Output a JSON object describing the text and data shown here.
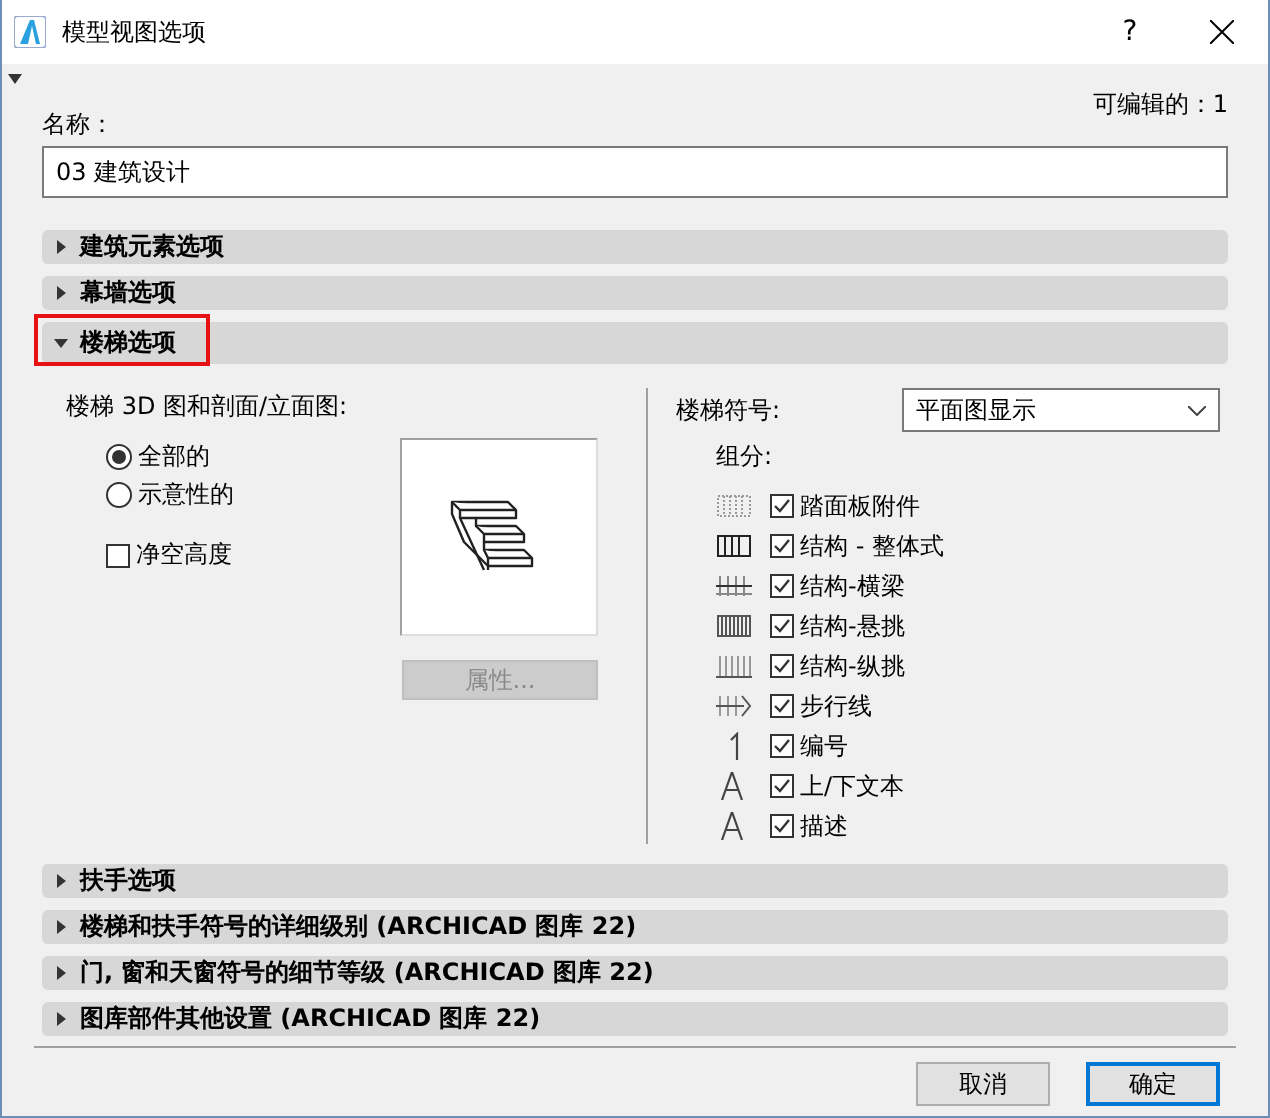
{
  "window": {
    "title": "模型视图选项",
    "help": "?"
  },
  "editable": {
    "label": "可编辑的：",
    "value": "1"
  },
  "name_field": {
    "label": "名称：",
    "value": "03 建筑设计"
  },
  "sections_top": [
    {
      "label": "建筑元素选项",
      "expanded": false,
      "highlighted": false
    },
    {
      "label": "幕墙选项",
      "expanded": false,
      "highlighted": false
    },
    {
      "label": "楼梯选项",
      "expanded": true,
      "highlighted": true
    }
  ],
  "stair_3d": {
    "label": "楼梯 3D 图和剖面/立面图:",
    "options": [
      {
        "label": "全部的",
        "selected": true
      },
      {
        "label": "示意性的",
        "selected": false
      }
    ],
    "clear_height": {
      "label": "净空高度",
      "checked": false
    },
    "properties_button": {
      "label": "属性...",
      "disabled": true
    }
  },
  "stair_symbol": {
    "label": "楼梯符号:",
    "value": "平面图显示",
    "components_label": "组分:",
    "components": [
      {
        "kind": "grid",
        "label": "踏面板附件",
        "checked": true
      },
      {
        "kind": "bars",
        "label": "结构 - 整体式",
        "checked": true
      },
      {
        "kind": "crossbar",
        "label": "结构-横梁",
        "checked": true
      },
      {
        "kind": "dense",
        "label": "结构-悬挑",
        "checked": true
      },
      {
        "kind": "underline",
        "label": "结构-纵挑",
        "checked": true
      },
      {
        "kind": "arrow",
        "label": "步行线",
        "checked": true
      },
      {
        "kind": "number",
        "label": "编号",
        "checked": true
      },
      {
        "kind": "letter",
        "label": "上/下文本",
        "checked": true
      },
      {
        "kind": "letter",
        "label": "描述",
        "checked": true
      }
    ]
  },
  "sections_bottom": [
    {
      "label": "扶手选项",
      "expanded": false
    },
    {
      "label": "楼梯和扶手符号的详细级别 (ARCHICAD 图库 22)",
      "expanded": false
    },
    {
      "label": "门, 窗和天窗符号的细节等级 (ARCHICAD 图库 22)",
      "expanded": false
    },
    {
      "label": "图库部件其他设置 (ARCHICAD 图库 22)",
      "expanded": false
    }
  ],
  "buttons": [
    {
      "label": "取消",
      "default": false
    },
    {
      "label": "确定",
      "default": true
    }
  ]
}
